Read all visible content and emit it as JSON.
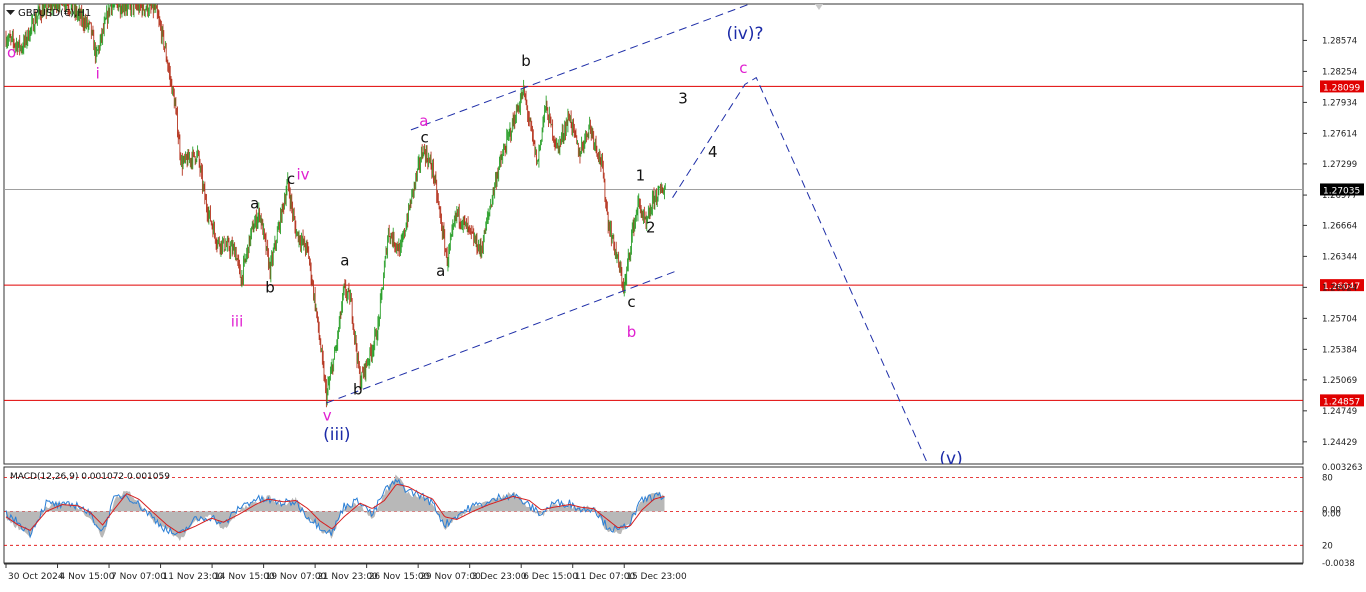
{
  "colors": {
    "bull": "#2ca02c",
    "bear": "#b5341f",
    "level_line": "#e00000",
    "price_line": "#a0a0a0",
    "channel": "#1f2fa8",
    "wave_blue": "#1c2ba8",
    "wave_magenta": "#e01fd0",
    "wave_black": "#111111",
    "macd_hist": "#b8b8b8",
    "macd_main": "#2a7fd6",
    "macd_signal": "#d62020",
    "level_label_bg": "#e00000",
    "price_label_bg": "#000000"
  },
  "chart_data": [
    {
      "type": "candlestick",
      "title": "GBPUSD(€),H1",
      "ylim": [
        1.242,
        1.2895
      ],
      "y_ticks": [
        "1.28574",
        "1.28254",
        "1.27934",
        "1.27614",
        "1.27299",
        "1.26977",
        "1.26664",
        "1.26344",
        "1.26024",
        "1.25704",
        "1.25384",
        "1.25069",
        "1.24749",
        "1.24429"
      ],
      "y_tick_values": [
        1.28574,
        1.28254,
        1.27934,
        1.27614,
        1.27299,
        1.26977,
        1.26664,
        1.26344,
        1.26024,
        1.25704,
        1.25384,
        1.25069,
        1.24749,
        1.24429
      ],
      "x_ticks": [
        "30 Oct 2024",
        "4 Nov 15:00",
        "7 Nov 07:00",
        "11 Nov 23:00",
        "14 Nov 15:00",
        "19 Nov 07:00",
        "21 Nov 23:00",
        "26 Nov 15:00",
        "29 Nov 07:00",
        "3 Dec 23:00",
        "6 Dec 15:00",
        "11 Dec 07:00",
        "15 Dec 23:00"
      ],
      "x_tick_index": [
        0,
        64,
        128,
        192,
        256,
        320,
        384,
        448,
        512,
        576,
        640,
        704,
        768
      ],
      "bar_count": 820,
      "price_path": [
        [
          0,
          1.286
        ],
        [
          20,
          1.285
        ],
        [
          40,
          1.2885
        ],
        [
          70,
          1.29
        ],
        [
          105,
          1.287
        ],
        [
          112,
          1.284
        ],
        [
          130,
          1.2895
        ],
        [
          185,
          1.289
        ],
        [
          195,
          1.286
        ],
        [
          210,
          1.279
        ],
        [
          218,
          1.273
        ],
        [
          238,
          1.274
        ],
        [
          248,
          1.269
        ],
        [
          262,
          1.265
        ],
        [
          285,
          1.264
        ],
        [
          292,
          1.261
        ],
        [
          305,
          1.266
        ],
        [
          315,
          1.268
        ],
        [
          328,
          1.262
        ],
        [
          350,
          1.271
        ],
        [
          360,
          1.266
        ],
        [
          375,
          1.264
        ],
        [
          385,
          1.258
        ],
        [
          398,
          1.249
        ],
        [
          410,
          1.254
        ],
        [
          420,
          1.26
        ],
        [
          428,
          1.259
        ],
        [
          440,
          1.2505
        ],
        [
          455,
          1.254
        ],
        [
          462,
          1.256
        ],
        [
          475,
          1.266
        ],
        [
          490,
          1.264
        ],
        [
          505,
          1.27
        ],
        [
          518,
          1.2745
        ],
        [
          530,
          1.2725
        ],
        [
          548,
          1.263
        ],
        [
          560,
          1.268
        ],
        [
          575,
          1.266
        ],
        [
          590,
          1.264
        ],
        [
          610,
          1.272
        ],
        [
          625,
          1.276
        ],
        [
          643,
          1.2805
        ],
        [
          660,
          1.273
        ],
        [
          670,
          1.279
        ],
        [
          685,
          1.2745
        ],
        [
          700,
          1.278
        ],
        [
          712,
          1.274
        ],
        [
          725,
          1.277
        ],
        [
          740,
          1.273
        ],
        [
          748,
          1.267
        ],
        [
          757,
          1.264
        ],
        [
          768,
          1.26
        ],
        [
          778,
          1.266
        ],
        [
          786,
          1.269
        ],
        [
          795,
          1.2665
        ],
        [
          805,
          1.2695
        ],
        [
          818,
          1.2705
        ]
      ],
      "levels": [
        {
          "value": 1.28099,
          "label": "1.28099"
        },
        {
          "value": 1.26047,
          "label": "1.26047"
        },
        {
          "value": 1.24857,
          "label": "1.24857"
        }
      ],
      "current_price": {
        "value": 1.27035,
        "label": "1.27035"
      },
      "channel_lines": [
        {
          "from": [
            503,
            1.2765
          ],
          "to": [
            940,
            1.29
          ]
        },
        {
          "from": [
            398,
            1.2483
          ],
          "to": [
            835,
            1.262
          ]
        }
      ],
      "projection": [
        [
          828,
          1.2695
        ],
        [
          918,
          1.2812
        ],
        [
          932,
          1.2819
        ],
        [
          1145,
          1.242
        ]
      ],
      "wave_labels": [
        {
          "text": "o",
          "bar": 7,
          "price": 1.284,
          "color": "magenta"
        },
        {
          "text": "i",
          "bar": 114,
          "price": 1.2818,
          "color": "magenta"
        },
        {
          "text": "iii",
          "bar": 287,
          "price": 1.2562,
          "color": "magenta"
        },
        {
          "text": "iv",
          "bar": 369,
          "price": 1.2714,
          "color": "magenta"
        },
        {
          "text": "v",
          "bar": 399,
          "price": 1.2465,
          "color": "magenta"
        },
        {
          "text": "(iii)",
          "bar": 411,
          "price": 1.2445,
          "color": "blue"
        },
        {
          "text": "a",
          "bar": 309,
          "price": 1.2684,
          "color": "black"
        },
        {
          "text": "b",
          "bar": 328,
          "price": 1.2597,
          "color": "black"
        },
        {
          "text": "c",
          "bar": 354,
          "price": 1.2709,
          "color": "black"
        },
        {
          "text": "a",
          "bar": 421,
          "price": 1.2625,
          "color": "black"
        },
        {
          "text": "b",
          "bar": 437,
          "price": 1.2492,
          "color": "black"
        },
        {
          "text": "a",
          "bar": 519,
          "price": 1.2769,
          "color": "magenta"
        },
        {
          "text": "c",
          "bar": 520,
          "price": 1.2752,
          "color": "black"
        },
        {
          "text": "a",
          "bar": 540,
          "price": 1.2614,
          "color": "black"
        },
        {
          "text": "b",
          "bar": 646,
          "price": 1.2831,
          "color": "black"
        },
        {
          "text": "1",
          "bar": 788,
          "price": 1.2713,
          "color": "black"
        },
        {
          "text": "2",
          "bar": 801,
          "price": 1.2659,
          "color": "black"
        },
        {
          "text": "3",
          "bar": 841,
          "price": 1.2792,
          "color": "black"
        },
        {
          "text": "4",
          "bar": 878,
          "price": 1.2737,
          "color": "black"
        },
        {
          "text": "c",
          "bar": 777,
          "price": 1.2582,
          "color": "black"
        },
        {
          "text": "b",
          "bar": 777,
          "price": 1.2551,
          "color": "magenta"
        },
        {
          "text": "c",
          "bar": 916,
          "price": 1.2824,
          "color": "magenta"
        },
        {
          "text": "(iv)?",
          "bar": 918,
          "price": 1.2859,
          "color": "blue"
        },
        {
          "text": "(v)",
          "bar": 1174,
          "price": 1.242,
          "color": "blue"
        }
      ]
    },
    {
      "type": "line",
      "title": "MACD(12,26,9) 0.001072 0.001059",
      "ylim": [
        -0.0038,
        0.003263
      ],
      "y_ticks": [
        "0.003263",
        "80",
        "0.00",
        "0.00",
        "20",
        "-0.0038"
      ],
      "series": [
        {
          "name": "histogram",
          "path": [
            [
              0,
              -0.0005
            ],
            [
              15,
              -0.0012
            ],
            [
              30,
              -0.0018
            ],
            [
              50,
              0.0004
            ],
            [
              70,
              0.0006
            ],
            [
              90,
              0.0003
            ],
            [
              105,
              -0.0005
            ],
            [
              120,
              -0.0019
            ],
            [
              135,
              0.0009
            ],
            [
              150,
              0.0016
            ],
            [
              165,
              0.0007
            ],
            [
              185,
              -0.0008
            ],
            [
              200,
              -0.0012
            ],
            [
              215,
              -0.0021
            ],
            [
              235,
              -0.0008
            ],
            [
              255,
              -0.0003
            ],
            [
              270,
              -0.0014
            ],
            [
              290,
              0.0001
            ],
            [
              310,
              0.0006
            ],
            [
              325,
              0.0011
            ],
            [
              345,
              0.0004
            ],
            [
              360,
              0.001
            ],
            [
              375,
              -0.0006
            ],
            [
              390,
              -0.0013
            ],
            [
              405,
              -0.0019
            ],
            [
              420,
              0.0003
            ],
            [
              440,
              0.0006
            ],
            [
              455,
              -0.0007
            ],
            [
              470,
              0.0013
            ],
            [
              485,
              0.0027
            ],
            [
              500,
              0.0013
            ],
            [
              515,
              0.0011
            ],
            [
              530,
              0.0007
            ],
            [
              545,
              -0.0013
            ],
            [
              560,
              -0.0005
            ],
            [
              580,
              0.0003
            ],
            [
              600,
              0.0008
            ],
            [
              615,
              0.001
            ],
            [
              630,
              0.0014
            ],
            [
              650,
              0.0003
            ],
            [
              665,
              -0.0004
            ],
            [
              680,
              0.0006
            ],
            [
              700,
              0.0004
            ],
            [
              715,
              0.0002
            ],
            [
              730,
              0.0004
            ],
            [
              745,
              -0.0013
            ],
            [
              760,
              -0.0017
            ],
            [
              775,
              -0.0009
            ],
            [
              790,
              0.0009
            ],
            [
              805,
              0.0013
            ],
            [
              818,
              0.0011
            ]
          ]
        },
        {
          "name": "main",
          "path": [
            [
              0,
              -0.0002
            ],
            [
              15,
              -0.0008
            ],
            [
              30,
              -0.0016
            ],
            [
              50,
              0.0006
            ],
            [
              70,
              0.0004
            ],
            [
              90,
              0.0005
            ],
            [
              105,
              -0.0003
            ],
            [
              120,
              -0.0015
            ],
            [
              135,
              0.001
            ],
            [
              150,
              0.0012
            ],
            [
              165,
              0.0005
            ],
            [
              185,
              -0.0006
            ],
            [
              200,
              -0.0014
            ],
            [
              215,
              -0.0018
            ],
            [
              235,
              -0.0006
            ],
            [
              255,
              -0.0004
            ],
            [
              270,
              -0.001
            ],
            [
              290,
              0.0003
            ],
            [
              310,
              0.0009
            ],
            [
              325,
              0.0008
            ],
            [
              345,
              0.0006
            ],
            [
              360,
              0.0007
            ],
            [
              375,
              -0.0004
            ],
            [
              390,
              -0.0011
            ],
            [
              405,
              -0.0016
            ],
            [
              420,
              0.0004
            ],
            [
              440,
              0.0008
            ],
            [
              455,
              -0.0003
            ],
            [
              470,
              0.0015
            ],
            [
              485,
              0.0022
            ],
            [
              500,
              0.0015
            ],
            [
              515,
              0.0012
            ],
            [
              530,
              0.0006
            ],
            [
              545,
              -0.001
            ],
            [
              560,
              -0.0003
            ],
            [
              580,
              0.0004
            ],
            [
              600,
              0.0006
            ],
            [
              615,
              0.0011
            ],
            [
              630,
              0.0012
            ],
            [
              650,
              0.0004
            ],
            [
              665,
              -0.0002
            ],
            [
              680,
              0.0006
            ],
            [
              700,
              0.0006
            ],
            [
              715,
              0.0001
            ],
            [
              730,
              0.0003
            ],
            [
              745,
              -0.001
            ],
            [
              760,
              -0.0015
            ],
            [
              775,
              -0.0008
            ],
            [
              790,
              0.0008
            ],
            [
              805,
              0.0011
            ],
            [
              818,
              0.0011
            ]
          ]
        },
        {
          "name": "signal",
          "path": [
            [
              0,
              -0.0004
            ],
            [
              15,
              -0.001
            ],
            [
              30,
              -0.0014
            ],
            [
              50,
              0.0
            ],
            [
              70,
              0.0005
            ],
            [
              90,
              0.0004
            ],
            [
              105,
              -0.0001
            ],
            [
              120,
              -0.001
            ],
            [
              135,
              0.0002
            ],
            [
              150,
              0.0013
            ],
            [
              165,
              0.0009
            ],
            [
              185,
              -0.0002
            ],
            [
              200,
              -0.001
            ],
            [
              215,
              -0.0016
            ],
            [
              235,
              -0.0011
            ],
            [
              255,
              -0.0005
            ],
            [
              270,
              -0.0008
            ],
            [
              290,
              -0.0002
            ],
            [
              310,
              0.0005
            ],
            [
              325,
              0.0009
            ],
            [
              345,
              0.0007
            ],
            [
              360,
              0.0008
            ],
            [
              375,
              0.0002
            ],
            [
              390,
              -0.0007
            ],
            [
              405,
              -0.0013
            ],
            [
              420,
              -0.0004
            ],
            [
              440,
              0.0006
            ],
            [
              455,
              0.0002
            ],
            [
              470,
              0.0008
            ],
            [
              485,
              0.002
            ],
            [
              500,
              0.0018
            ],
            [
              515,
              0.0013
            ],
            [
              530,
              0.0009
            ],
            [
              545,
              -0.0004
            ],
            [
              560,
              -0.0006
            ],
            [
              580,
              0.0
            ],
            [
              600,
              0.0005
            ],
            [
              615,
              0.0008
            ],
            [
              630,
              0.0011
            ],
            [
              650,
              0.0008
            ],
            [
              665,
              0.0001
            ],
            [
              680,
              0.0003
            ],
            [
              700,
              0.0005
            ],
            [
              715,
              0.0003
            ],
            [
              730,
              0.0002
            ],
            [
              745,
              -0.0005
            ],
            [
              760,
              -0.0012
            ],
            [
              775,
              -0.0011
            ],
            [
              790,
              0.0001
            ],
            [
              805,
              0.0009
            ],
            [
              818,
              0.0011
            ]
          ]
        }
      ],
      "dashed_levels": [
        0.0025,
        0.0,
        -0.0025
      ]
    }
  ]
}
